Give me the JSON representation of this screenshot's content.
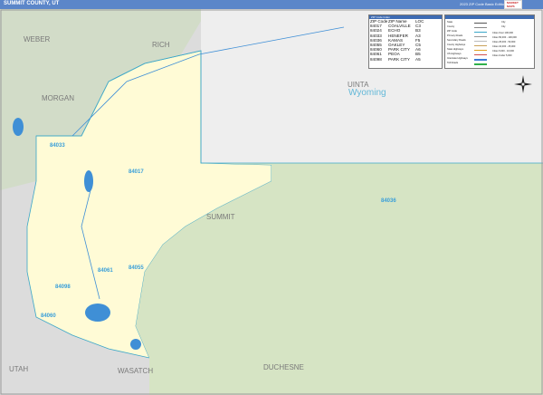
{
  "header": {
    "title": "SUMMIT COUNTY, UT",
    "edition": "2023 ZIP Code Basic Edition",
    "logo": "MARKET MAPS"
  },
  "map": {
    "state_label": "Wyoming",
    "county_labels": [
      "WEBER",
      "RICH",
      "MORGAN",
      "UINTA",
      "SUMMIT",
      "UTAH",
      "WASATCH",
      "DUCHESNE"
    ],
    "zip_labels": [
      "84033",
      "84017",
      "84036",
      "84061",
      "84055",
      "84098",
      "84060"
    ]
  },
  "zip_table": {
    "title": "ZIP Code Index",
    "headers": [
      "ZIP Code",
      "ZIP Name",
      "LOC"
    ],
    "rows": [
      [
        "84017",
        "COALVILLE",
        "C3"
      ],
      [
        "84024",
        "ECHO",
        "B3"
      ],
      [
        "84033",
        "HENEFER",
        "A3"
      ],
      [
        "84036",
        "KAMAS",
        "F5"
      ],
      [
        "84055",
        "OAKLEY",
        "C5"
      ],
      [
        "84060",
        "PARK CITY",
        "A6"
      ],
      [
        "84061",
        "PEOA",
        "B5"
      ],
      [
        "84098",
        "PARK CITY",
        "A5"
      ]
    ]
  },
  "legend": {
    "left_items": [
      "State",
      "County",
      "ZIP Code",
      "Primary Roads",
      "Secondary Roads",
      "County Highways",
      "State Highways",
      "US Highways",
      "Interstate Highways",
      "Toll Roads"
    ],
    "right_items": [
      "City",
      "City",
      "Cities Over 100,000",
      "Cities 50,000 - 100,000",
      "Cities 25,000 - 50,000",
      "Cities 10,000 - 25,000",
      "Cities 5,000 - 10,000",
      "Cities Under 5,000"
    ]
  },
  "colors": {
    "title_bar": "#5b86c9",
    "land_yellow": "#fffbd6",
    "forest_green": "#d6e4c4",
    "outside_gray": "#d9d9d9",
    "water": "#3f8fd6",
    "zip_label": "#3a9fd9",
    "county_label": "#7a7a7a",
    "state_label": "#63b8d8"
  }
}
